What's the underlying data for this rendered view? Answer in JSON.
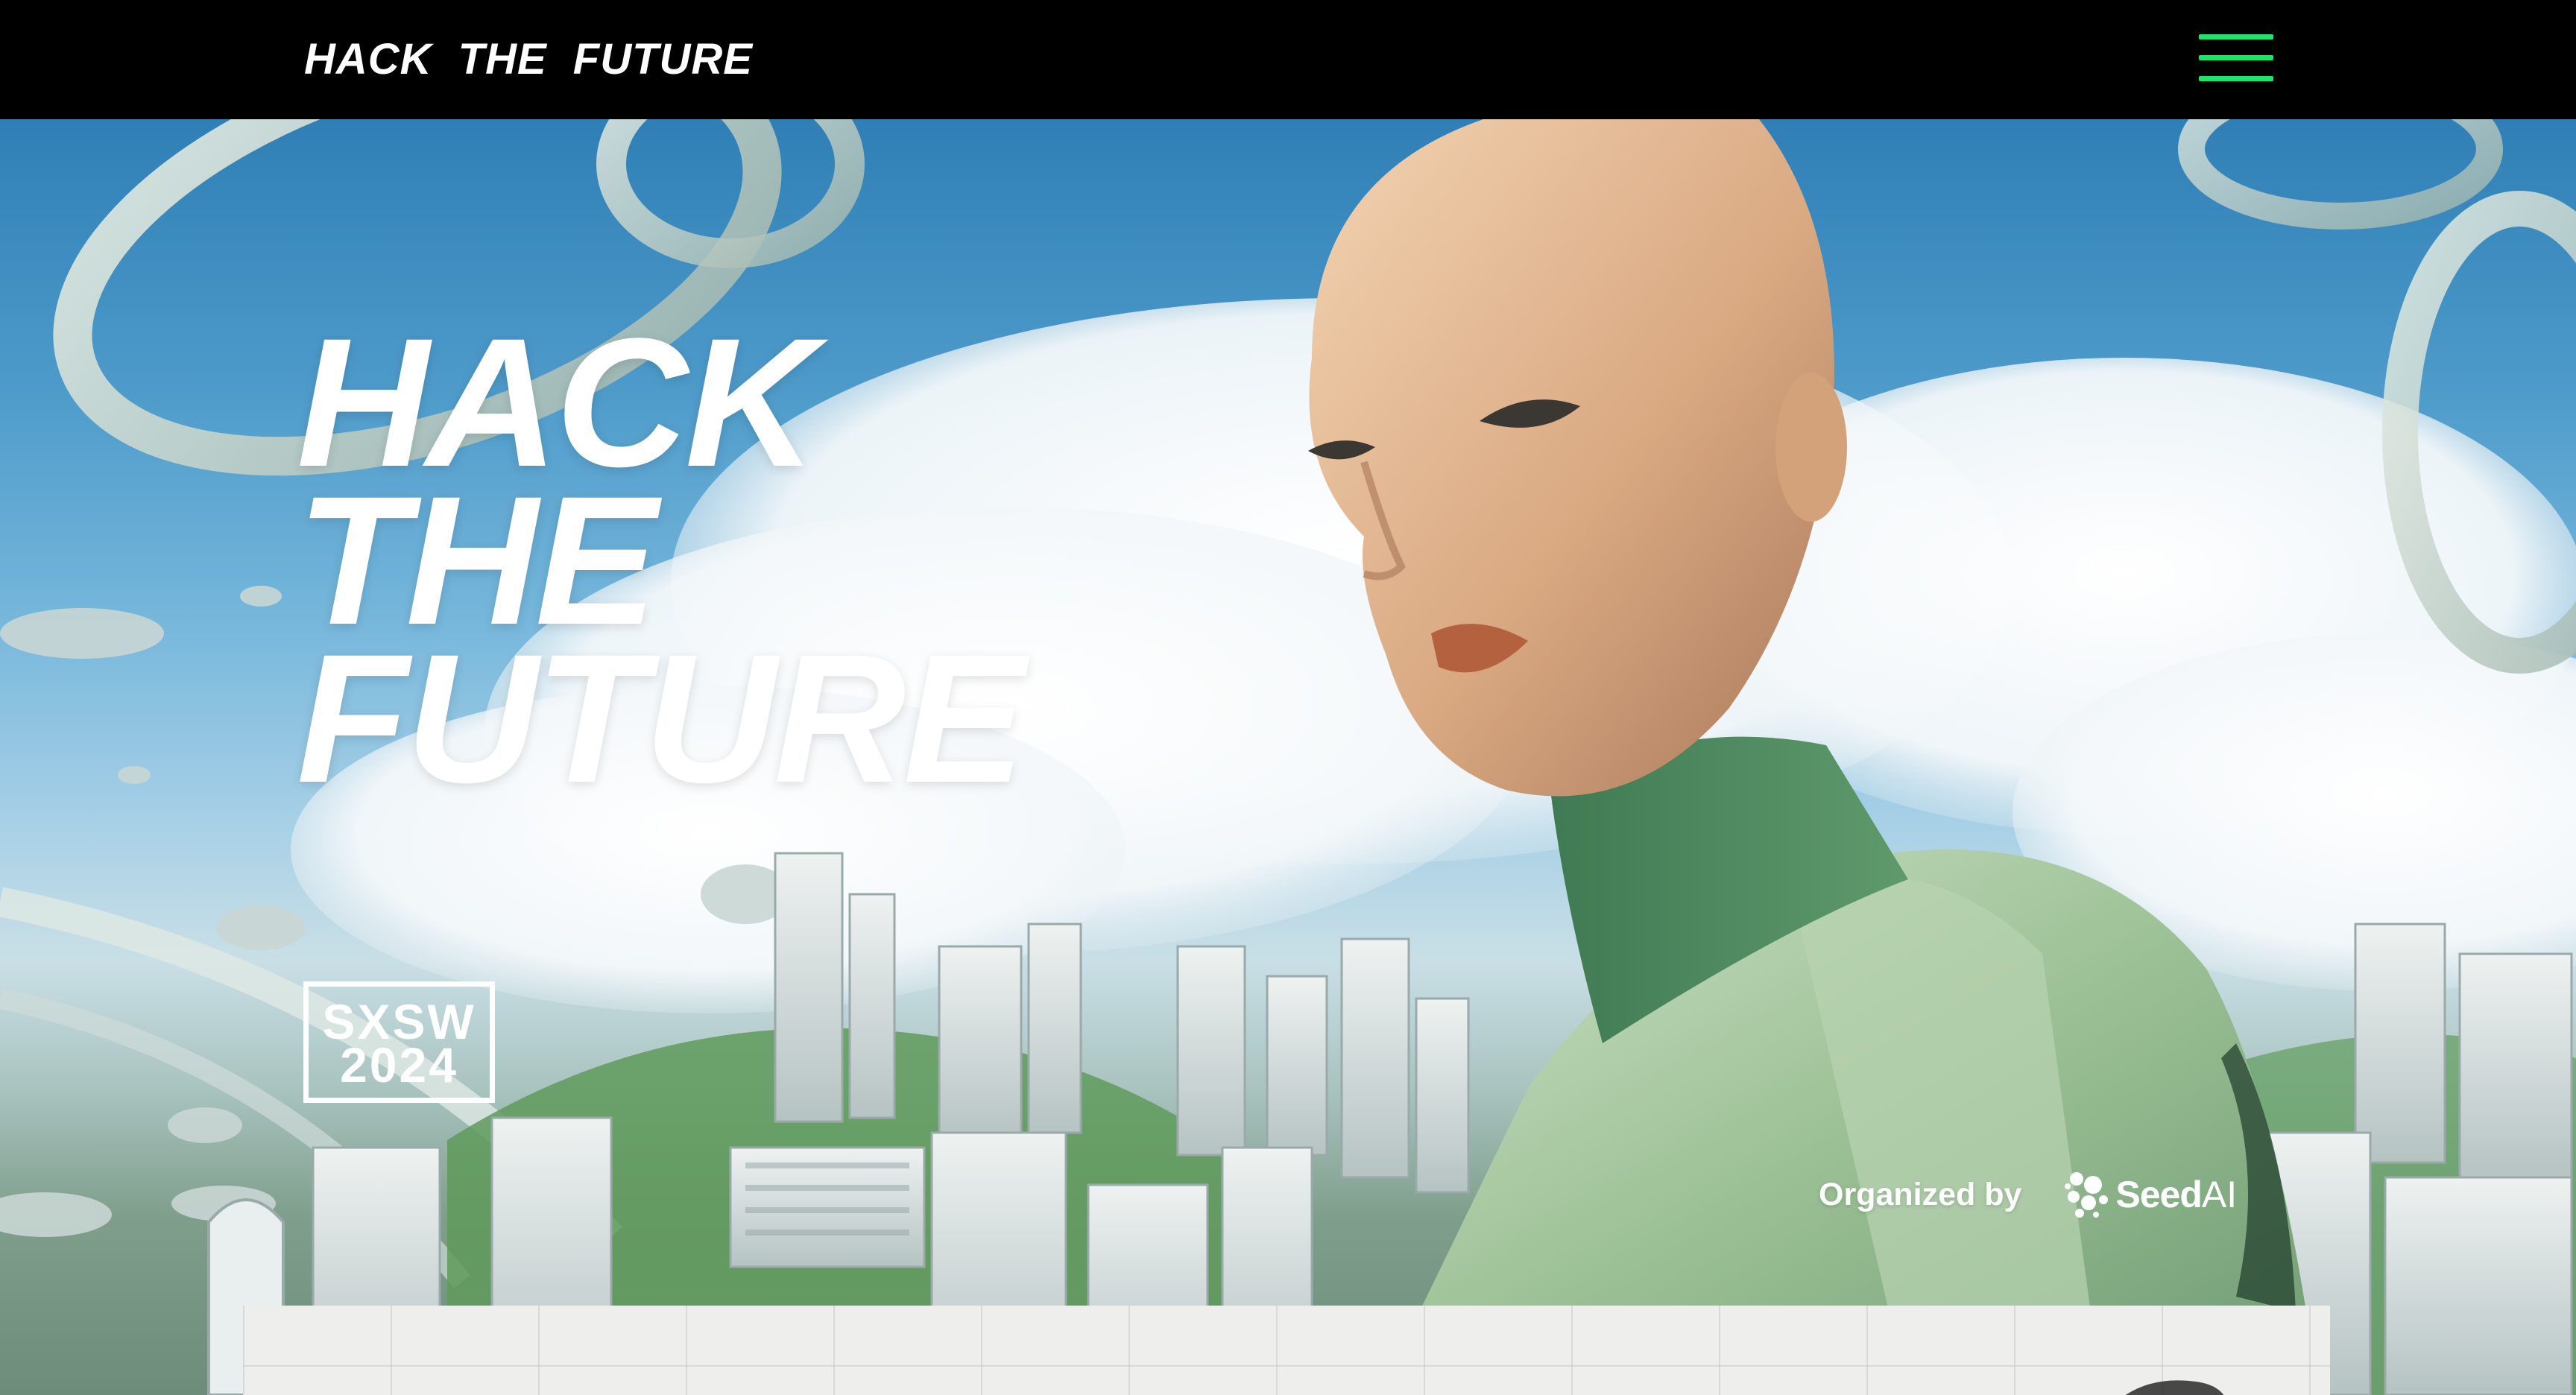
{
  "nav": {
    "brand": "HACK THE FUTURE",
    "menu_icon": "hamburger-menu-icon"
  },
  "hero": {
    "title_lines": [
      "HACK",
      "THE",
      "FUTURE"
    ],
    "badge_lines": [
      "SXSW",
      "2024"
    ],
    "organized_label": "Organized by",
    "organizer": {
      "logo_icon": "seed-ai-logo-icon",
      "name": "Seed",
      "suffix": "AI"
    }
  },
  "colors": {
    "topbar_bg": "#000000",
    "accent_green": "#1fe36a",
    "hero_text": "#ffffff"
  }
}
